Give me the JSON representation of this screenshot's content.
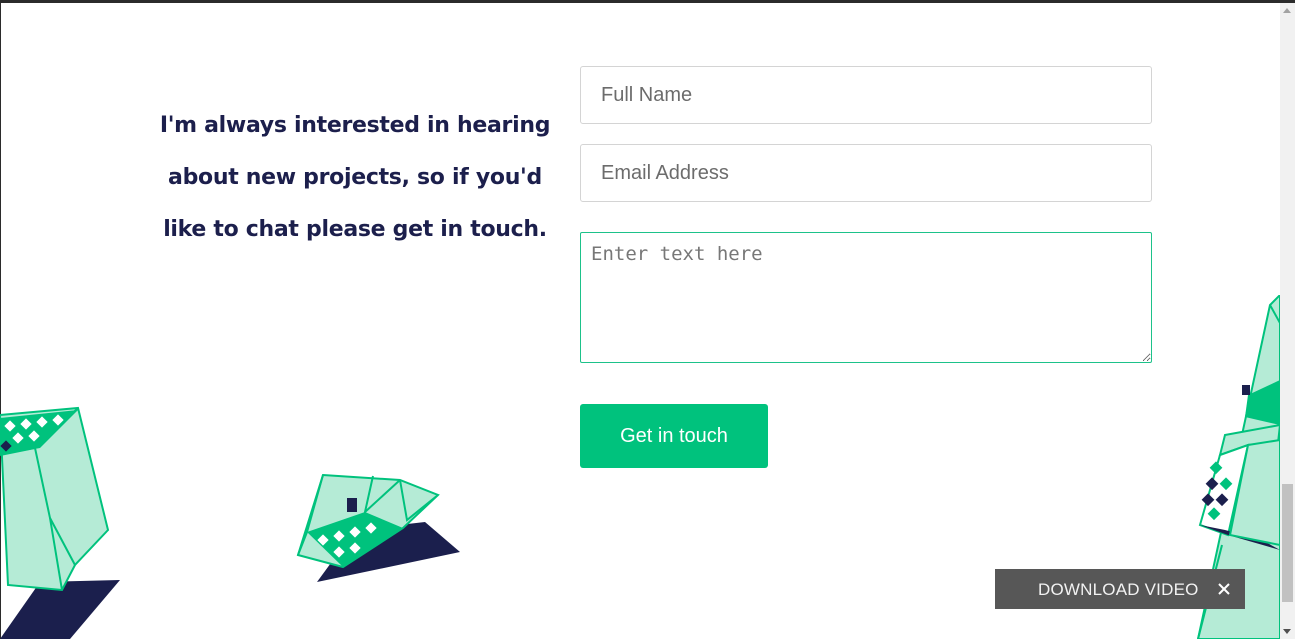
{
  "intro": {
    "line1": "I'm always interested in hearing",
    "line2": "about new projects, so if you'd",
    "line3": "like to chat please get in touch."
  },
  "form": {
    "name_placeholder": "Full Name",
    "email_placeholder": "Email Address",
    "message_placeholder": "Enter text here",
    "submit_label": "Get in touch"
  },
  "download_bar": {
    "label": "DOWNLOAD VIDEO",
    "close_icon": "close-icon"
  },
  "colors": {
    "heading": "#1c1f4c",
    "accent": "#00c27d",
    "decor_light": "#b5ebd6",
    "decor_dark": "#1b1f4d"
  }
}
